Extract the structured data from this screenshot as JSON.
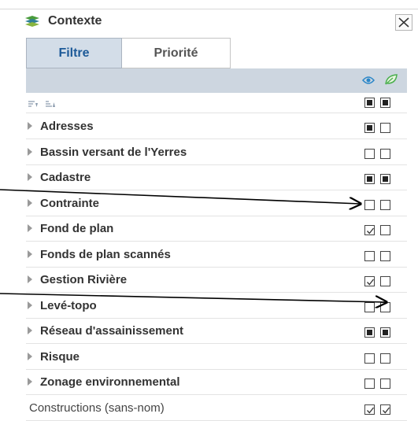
{
  "panel": {
    "title": "Contexte",
    "close_symbol": "✕"
  },
  "tabs": [
    {
      "label": "Filtre",
      "active": true
    },
    {
      "label": "Priorité",
      "active": false
    }
  ],
  "column_icons": [
    "eye-icon",
    "leaf-icon"
  ],
  "sort_row": {
    "icons": [
      "sort-descending-icon",
      "sort-ascending-icon"
    ],
    "col1": "full",
    "col2": "full"
  },
  "layers": [
    {
      "label": "Adresses",
      "group": true,
      "col1": "full",
      "col2": "empty"
    },
    {
      "label": "Bassin versant de l'Yerres",
      "group": true,
      "col1": "empty",
      "col2": "empty"
    },
    {
      "label": "Cadastre",
      "group": true,
      "col1": "full",
      "col2": "full"
    },
    {
      "label": "Contrainte",
      "group": true,
      "col1": "empty",
      "col2": "empty"
    },
    {
      "label": "Fond de plan",
      "group": true,
      "col1": "check",
      "col2": "empty"
    },
    {
      "label": "Fonds de plan scannés",
      "group": true,
      "col1": "empty",
      "col2": "empty"
    },
    {
      "label": "Gestion Rivière",
      "group": true,
      "col1": "check",
      "col2": "empty"
    },
    {
      "label": "Levé-topo",
      "group": true,
      "col1": "empty",
      "col2": "empty"
    },
    {
      "label": "Réseau d'assainissement",
      "group": true,
      "col1": "full",
      "col2": "full"
    },
    {
      "label": "Risque",
      "group": true,
      "col1": "empty",
      "col2": "empty"
    },
    {
      "label": "Zonage environnemental",
      "group": true,
      "col1": "empty",
      "col2": "empty"
    },
    {
      "label": "Constructions (sans-nom)",
      "group": false,
      "col1": "check",
      "col2": "check"
    }
  ],
  "colors": {
    "accent": "#1d5a98",
    "tab_active_bg": "#d3dde8",
    "header_bar": "#cdd6e0",
    "eye": "#2a86c8",
    "leaf": "#4caf50"
  }
}
